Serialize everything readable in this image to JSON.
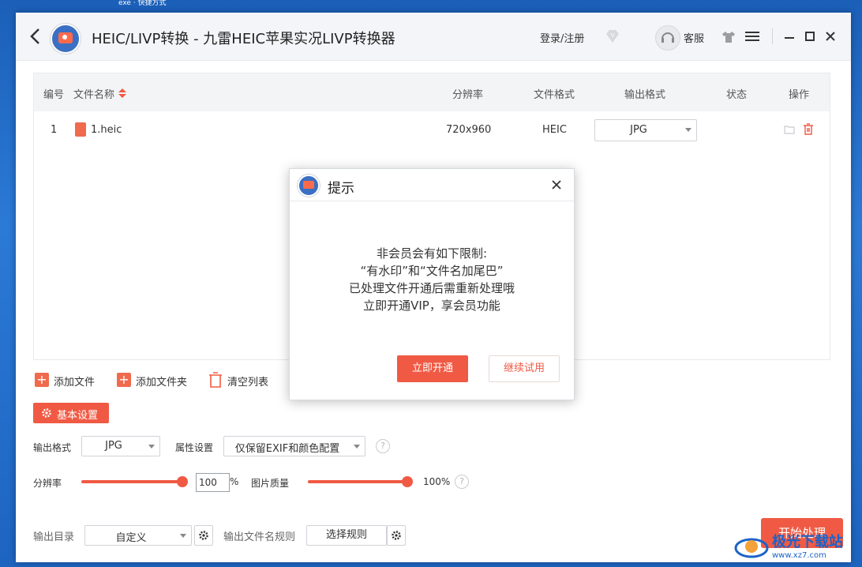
{
  "desktop": {
    "top_text": "exe · 快捷方式"
  },
  "titlebar": {
    "title": "HEIC/LIVP转换 - 九雷HEIC苹果实况LIVP转换器",
    "login_label": "登录/注册",
    "service_label": "客服"
  },
  "table": {
    "headers": {
      "index": "编号",
      "name": "文件名称",
      "resolution": "分辨率",
      "file_format": "文件格式",
      "output_format": "输出格式",
      "status": "状态",
      "action": "操作"
    },
    "rows": [
      {
        "index": "1",
        "name": "1.heic",
        "resolution": "720x960",
        "file_format": "HEIC",
        "output_format": "JPG",
        "status": ""
      }
    ]
  },
  "toolbar": {
    "add_file": "添加文件",
    "add_folder": "添加文件夹",
    "clear_list": "清空列表"
  },
  "settings": {
    "basic_label": "基本设置",
    "output_format_label": "输出格式",
    "output_format_value": "JPG",
    "attr_label": "属性设置",
    "attr_value": "仅保留EXIF和颜色配置",
    "resolution_label": "分辨率",
    "resolution_value": "100",
    "resolution_unit": "%",
    "quality_label": "图片质量",
    "quality_value": "100%",
    "resolution_level": 1.0,
    "quality_level": 1.0
  },
  "output": {
    "dir_label": "输出目录",
    "dir_value": "自定义",
    "rule_label": "输出文件名规则",
    "rule_button": "选择规则",
    "start_button": "开始处理"
  },
  "modal": {
    "title": "提示",
    "lines": [
      "非会员会有如下限制:",
      "“有水印”和“文件名加尾巴”",
      "已处理文件开通后需重新处理哦",
      "立即开通VIP，享会员功能"
    ],
    "primary": "立即开通",
    "secondary": "继续试用"
  },
  "watermark": {
    "text": "极光下载站",
    "url": "www.xz7.com"
  },
  "colors": {
    "accent": "#f05a44",
    "brand_blue": "#3b6fc4"
  }
}
